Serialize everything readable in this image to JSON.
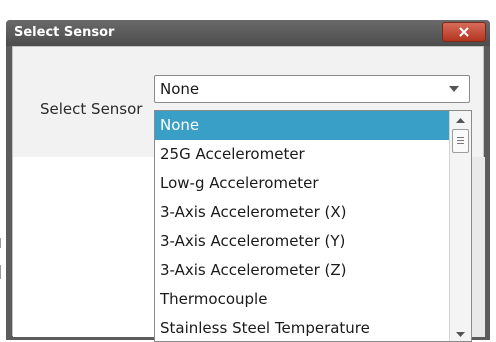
{
  "dialog": {
    "title": "Select Sensor",
    "close_label": "x"
  },
  "form": {
    "label": "Select Sensor",
    "selected_value": "None"
  },
  "dropdown": {
    "options": [
      "None",
      "25G Accelerometer",
      "Low-g Accelerometer",
      "3-Axis Accelerometer (X)",
      "3-Axis Accelerometer (Y)",
      "3-Axis Accelerometer (Z)",
      "Thermocouple",
      "Stainless Steel Temperature"
    ],
    "selected_index": 0
  },
  "icons": {
    "close": "close-icon",
    "select_arrow": "chevron-down-icon",
    "scroll_up": "scroll-up-icon",
    "scroll_down": "scroll-down-icon"
  },
  "colors": {
    "title_bar": "#5c5c5c",
    "close_button": "#c2452e",
    "selection": "#3a9fc6"
  }
}
